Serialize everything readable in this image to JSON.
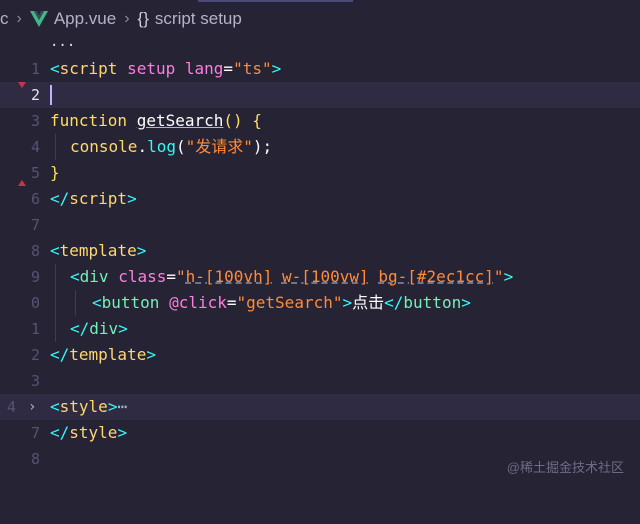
{
  "breadcrumb": {
    "root": "c",
    "file": "App.vue",
    "symbol": "script setup",
    "symbol_icon": "{}"
  },
  "editor": {
    "collapsed_marker": "...",
    "lines": [
      {
        "num": "1"
      },
      {
        "num": "2"
      },
      {
        "num": "3"
      },
      {
        "num": "4"
      },
      {
        "num": "5"
      },
      {
        "num": "6"
      },
      {
        "num": "7"
      },
      {
        "num": "8"
      },
      {
        "num": "9"
      },
      {
        "num": "0"
      },
      {
        "num": "1"
      },
      {
        "num": "2"
      },
      {
        "num": "3"
      },
      {
        "num": "4"
      },
      {
        "num": "7"
      },
      {
        "num": "8"
      }
    ],
    "code": {
      "l1_tag": "script",
      "l1_attr1": "setup",
      "l1_attr2": "lang",
      "l1_val": "\"ts\"",
      "l3_kw": "function",
      "l3_name": "getSearch",
      "l3_rest": "() {",
      "l4_obj": "console",
      "l4_fn": "log",
      "l4_str": "\"发请求\"",
      "l5": "}",
      "l6_tag": "script",
      "l8_tag": "template",
      "l9_tag": "div",
      "l9_attr": "class",
      "l9_v1": "h-[100vh]",
      "l9_v2": "w-[100vw]",
      "l9_v3": "bg-[#2ec1cc]",
      "l10_tag": "button",
      "l10_attr": "@click",
      "l10_val": "\"getSearch\"",
      "l10_text": "点击",
      "l11_tag": "div",
      "l12_tag": "template",
      "l14_tag": "style",
      "l14_dots": "⋯",
      "l17_tag": "style"
    }
  },
  "watermark": "@稀土掘金技术社区",
  "colors": {
    "background": "#262335",
    "accent": "#36f9f6",
    "tag": "#ffd76d"
  }
}
